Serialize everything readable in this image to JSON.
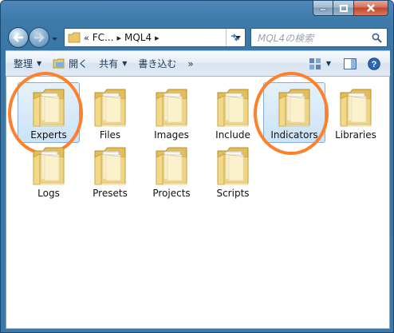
{
  "window": {
    "caption_buttons": [
      "minimize",
      "maximize",
      "close"
    ]
  },
  "navigation": {
    "back_icon": "back-arrow-icon",
    "forward_icon": "forward-arrow-icon",
    "breadcrumb": {
      "overflow": "«",
      "items": [
        "FC...",
        "MQL4"
      ]
    },
    "search_placeholder": "MQL4の検索"
  },
  "commandbar": {
    "organize": "整理",
    "open": "開く",
    "share": "共有",
    "burn": "書き込む",
    "more": "»"
  },
  "folders": [
    {
      "name": "Experts",
      "selected": true,
      "highlighted": true
    },
    {
      "name": "Files"
    },
    {
      "name": "Images"
    },
    {
      "name": "Include"
    },
    {
      "name": "Indicators",
      "selected": true,
      "highlighted": true
    },
    {
      "name": "Libraries"
    },
    {
      "name": "Logs"
    },
    {
      "name": "Presets"
    },
    {
      "name": "Projects"
    },
    {
      "name": "Scripts"
    }
  ],
  "colors": {
    "annotation": "#ff7f2a",
    "folder_light": "#f9e7a5",
    "folder_dark": "#e2bd5a",
    "frame": "#3d79a8"
  }
}
